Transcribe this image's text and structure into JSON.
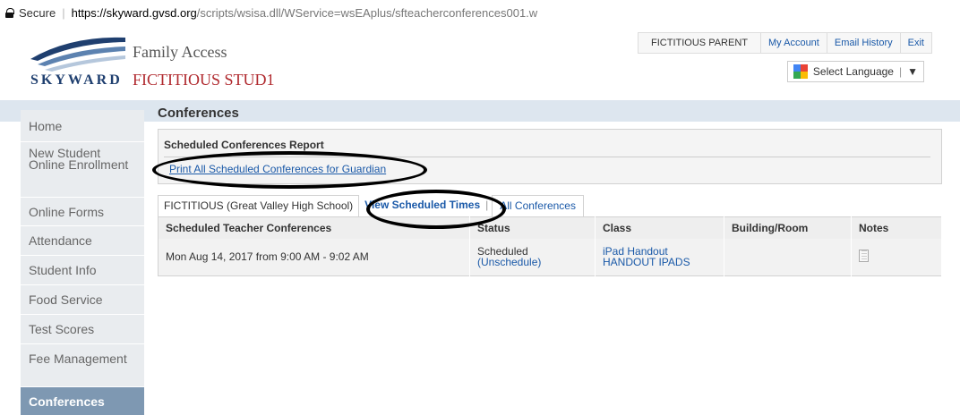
{
  "browser": {
    "secure_label": "Secure",
    "url_domain": "https://skyward.gvsd.org",
    "url_path": "/scripts/wsisa.dll/WService=wsEAplus/sfteacherconferences001.w"
  },
  "header": {
    "logo_text": "SKYWARD",
    "app_title": "Family Access",
    "student_name": "FICTITIOUS STUD1",
    "parent_name": "FICTITIOUS PARENT",
    "my_account": "My Account",
    "email_history": "Email History",
    "exit": "Exit",
    "language": "Select Language",
    "language_arrow": "▼"
  },
  "sidebar": {
    "items": [
      {
        "label": "Home"
      },
      {
        "label": "New Student Online Enrollment"
      },
      {
        "label": "Online Forms"
      },
      {
        "label": "Attendance"
      },
      {
        "label": "Student Info"
      },
      {
        "label": "Food Service"
      },
      {
        "label": "Test Scores"
      },
      {
        "label": "Fee Management"
      },
      {
        "label": "Conferences"
      }
    ]
  },
  "main": {
    "title": "Conferences",
    "report": {
      "title": "Scheduled Conferences Report",
      "link": "Print All Scheduled Conferences for Guardian"
    },
    "tabs": {
      "student": "FICTITIOUS (Great Valley High School)",
      "view_times": "View Scheduled Times",
      "all": "All Conferences"
    },
    "table": {
      "headers": [
        "Scheduled Teacher Conferences",
        "Status",
        "Class",
        "Building/Room",
        "Notes"
      ],
      "rows": [
        {
          "when": "Mon Aug 14, 2017 from 9:00 AM - 9:02 AM",
          "status": "Scheduled",
          "unschedule": "(Unschedule)",
          "class_line1": "iPad Handout",
          "class_line2": "HANDOUT IPADS",
          "room": "",
          "notes_icon": "notes-icon"
        }
      ]
    }
  },
  "colors": {
    "link": "#1a59a8",
    "student_name": "#b0292e",
    "sidebar_active": "#7e98b2",
    "stripe": "#dde6ef"
  }
}
